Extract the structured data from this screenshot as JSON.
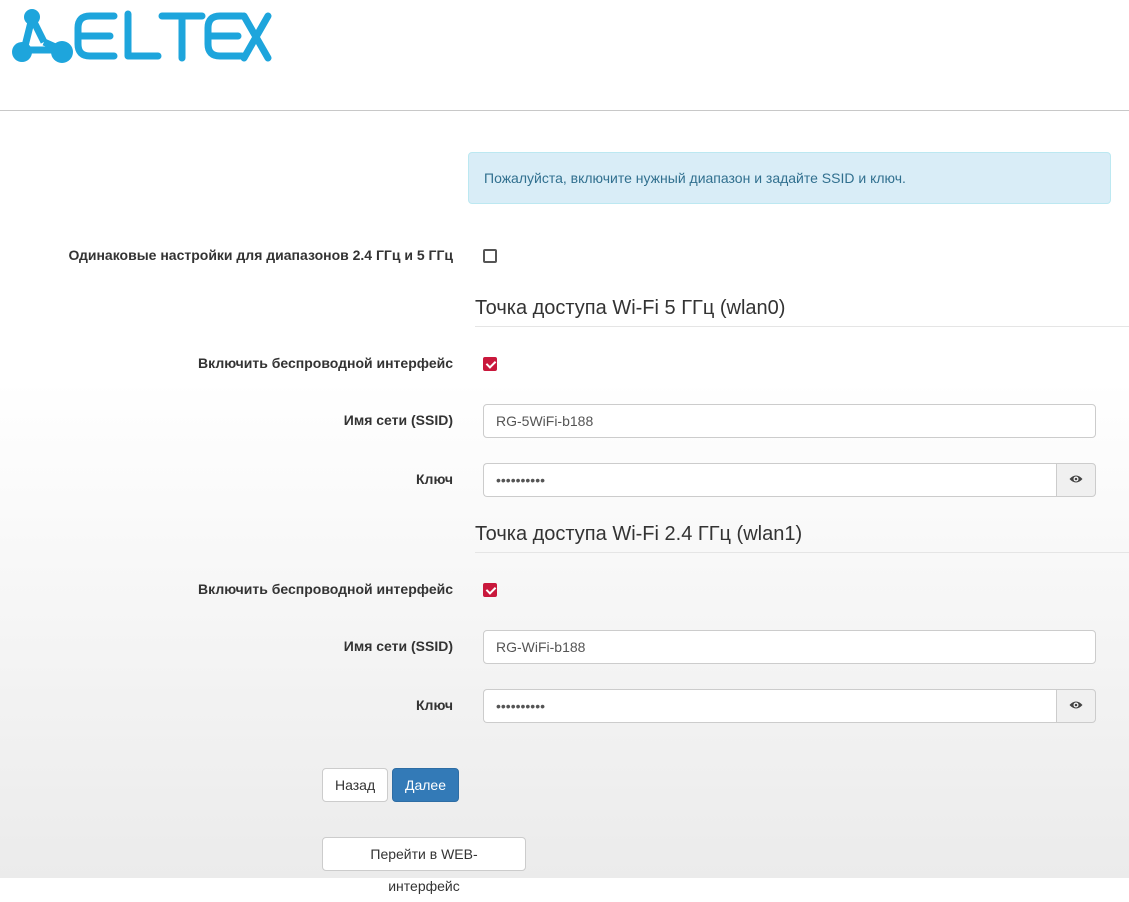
{
  "header": {
    "logo_text": "ELTEX"
  },
  "alert": {
    "text": "Пожалуйста, включите нужный диапазон и задайте SSID и ключ."
  },
  "same_settings": {
    "label": "Одинаковые настройки для диапазонов 2.4 ГГц и 5 ГГц",
    "checked": false
  },
  "wlan0": {
    "title": "Точка доступа Wi-Fi 5 ГГц (wlan0)",
    "enable_label": "Включить беспроводной интерфейс",
    "enabled": true,
    "ssid_label": "Имя сети (SSID)",
    "ssid_value": "RG-5WiFi-b188",
    "key_label": "Ключ",
    "key_value": "••••••••••"
  },
  "wlan1": {
    "title": "Точка доступа Wi-Fi 2.4 ГГц (wlan1)",
    "enable_label": "Включить беспроводной интерфейс",
    "enabled": true,
    "ssid_label": "Имя сети (SSID)",
    "ssid_value": "RG-WiFi-b188",
    "key_label": "Ключ",
    "key_value": "••••••••••"
  },
  "buttons": {
    "back": "Назад",
    "next": "Далее",
    "web": "Перейти в WEB-интерфейс"
  },
  "colors": {
    "brand": "#1ea5dc",
    "checkbox_checked": "#c9183c",
    "primary": "#337ab7",
    "alert_bg": "#d9edf7"
  }
}
